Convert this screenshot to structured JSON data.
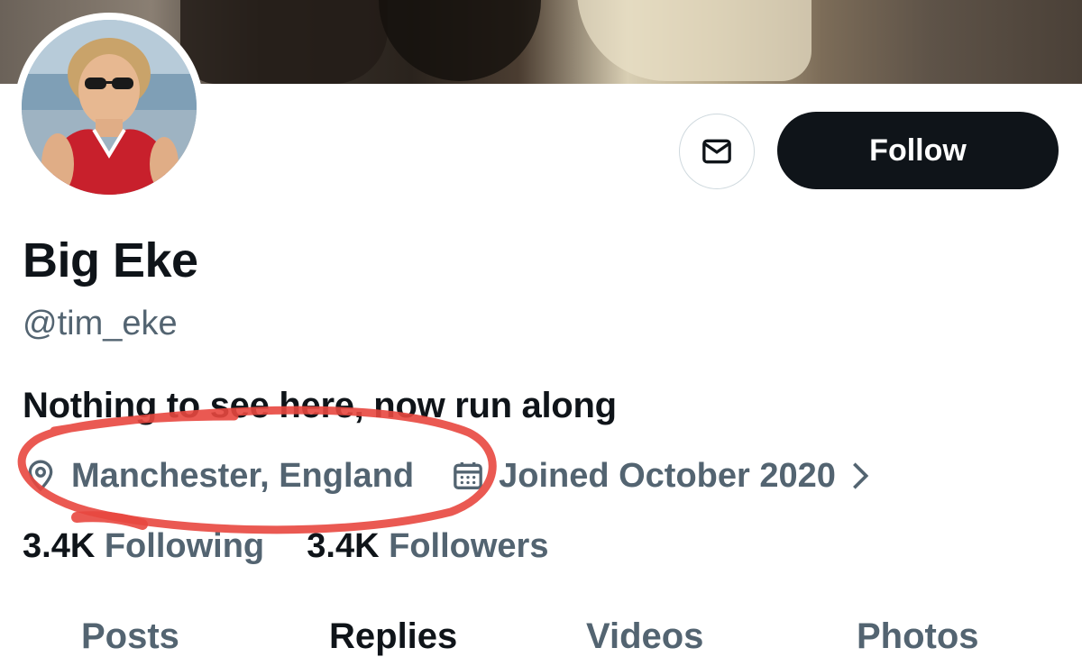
{
  "profile": {
    "display_name": "Big Eke",
    "handle": "@tim_eke",
    "bio": "Nothing to see here, now run along",
    "location": "Manchester, England",
    "joined": "Joined October 2020",
    "following_count": "3.4K",
    "following_label": "Following",
    "followers_count": "3.4K",
    "followers_label": "Followers"
  },
  "actions": {
    "follow_label": "Follow",
    "message_icon": "envelope-icon"
  },
  "tabs": [
    {
      "label": "Posts"
    },
    {
      "label": "Replies"
    },
    {
      "label": "Videos"
    },
    {
      "label": "Photos"
    }
  ],
  "colors": {
    "text_primary": "#0f1419",
    "text_secondary": "#536471",
    "annotation": "#e8473f"
  }
}
